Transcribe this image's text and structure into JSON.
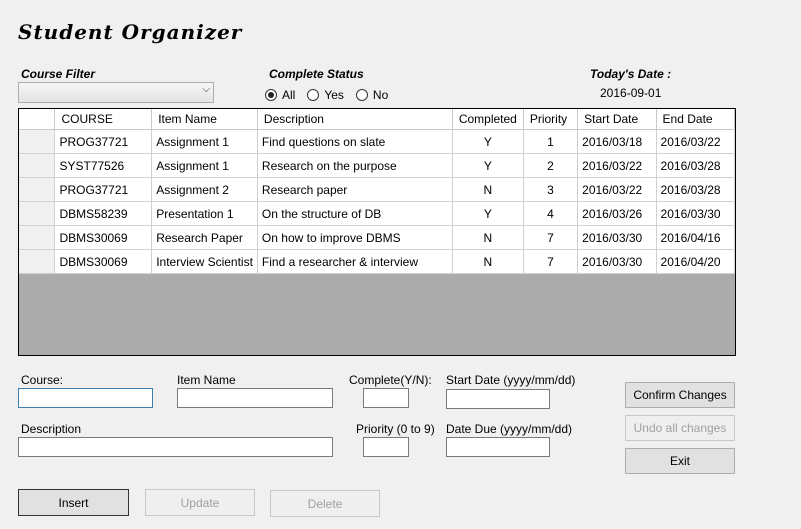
{
  "app": {
    "title": "Student Organizer"
  },
  "filters": {
    "course_label": "Course Filter",
    "course_value": "",
    "status_label": "Complete Status",
    "status_options": [
      "All",
      "Yes",
      "No"
    ],
    "status_selected": "All",
    "date_label": "Today's Date :",
    "date_value": "2016-09-01"
  },
  "table": {
    "columns": [
      "COURSE",
      "Item Name",
      "Description",
      "Completed",
      "Priority",
      "Start Date",
      "End Date"
    ],
    "rows": [
      [
        "PROG37721",
        "Assignment 1",
        "Find questions on slate",
        "Y",
        "1",
        "2016/03/18",
        "2016/03/22"
      ],
      [
        "SYST77526",
        "Assignment 1",
        "Research on the purpose",
        "Y",
        "2",
        "2016/03/22",
        "2016/03/28"
      ],
      [
        "PROG37721",
        "Assignment 2",
        "Research paper",
        "N",
        "3",
        "2016/03/22",
        "2016/03/28"
      ],
      [
        "DBMS58239",
        "Presentation 1",
        "On the structure of DB",
        "Y",
        "4",
        "2016/03/26",
        "2016/03/30"
      ],
      [
        "DBMS30069",
        "Research Paper",
        "On how to improve DBMS",
        "N",
        "7",
        "2016/03/30",
        "2016/04/16"
      ],
      [
        "DBMS30069",
        "Interview Scientist",
        "Find a researcher & interview",
        "N",
        "7",
        "2016/03/30",
        "2016/04/20"
      ]
    ]
  },
  "form": {
    "course_label": "Course:",
    "item_label": "Item Name",
    "complete_label": "Complete(Y/N):",
    "start_label": "Start Date (yyyy/mm/dd)",
    "description_label": "Description",
    "priority_label": "Priority (0 to 9)",
    "due_label": "Date Due (yyyy/mm/dd)"
  },
  "buttons": {
    "confirm": "Confirm Changes",
    "undo": "Undo all changes",
    "exit": "Exit",
    "insert": "Insert",
    "update": "Update",
    "delete": "Delete"
  }
}
